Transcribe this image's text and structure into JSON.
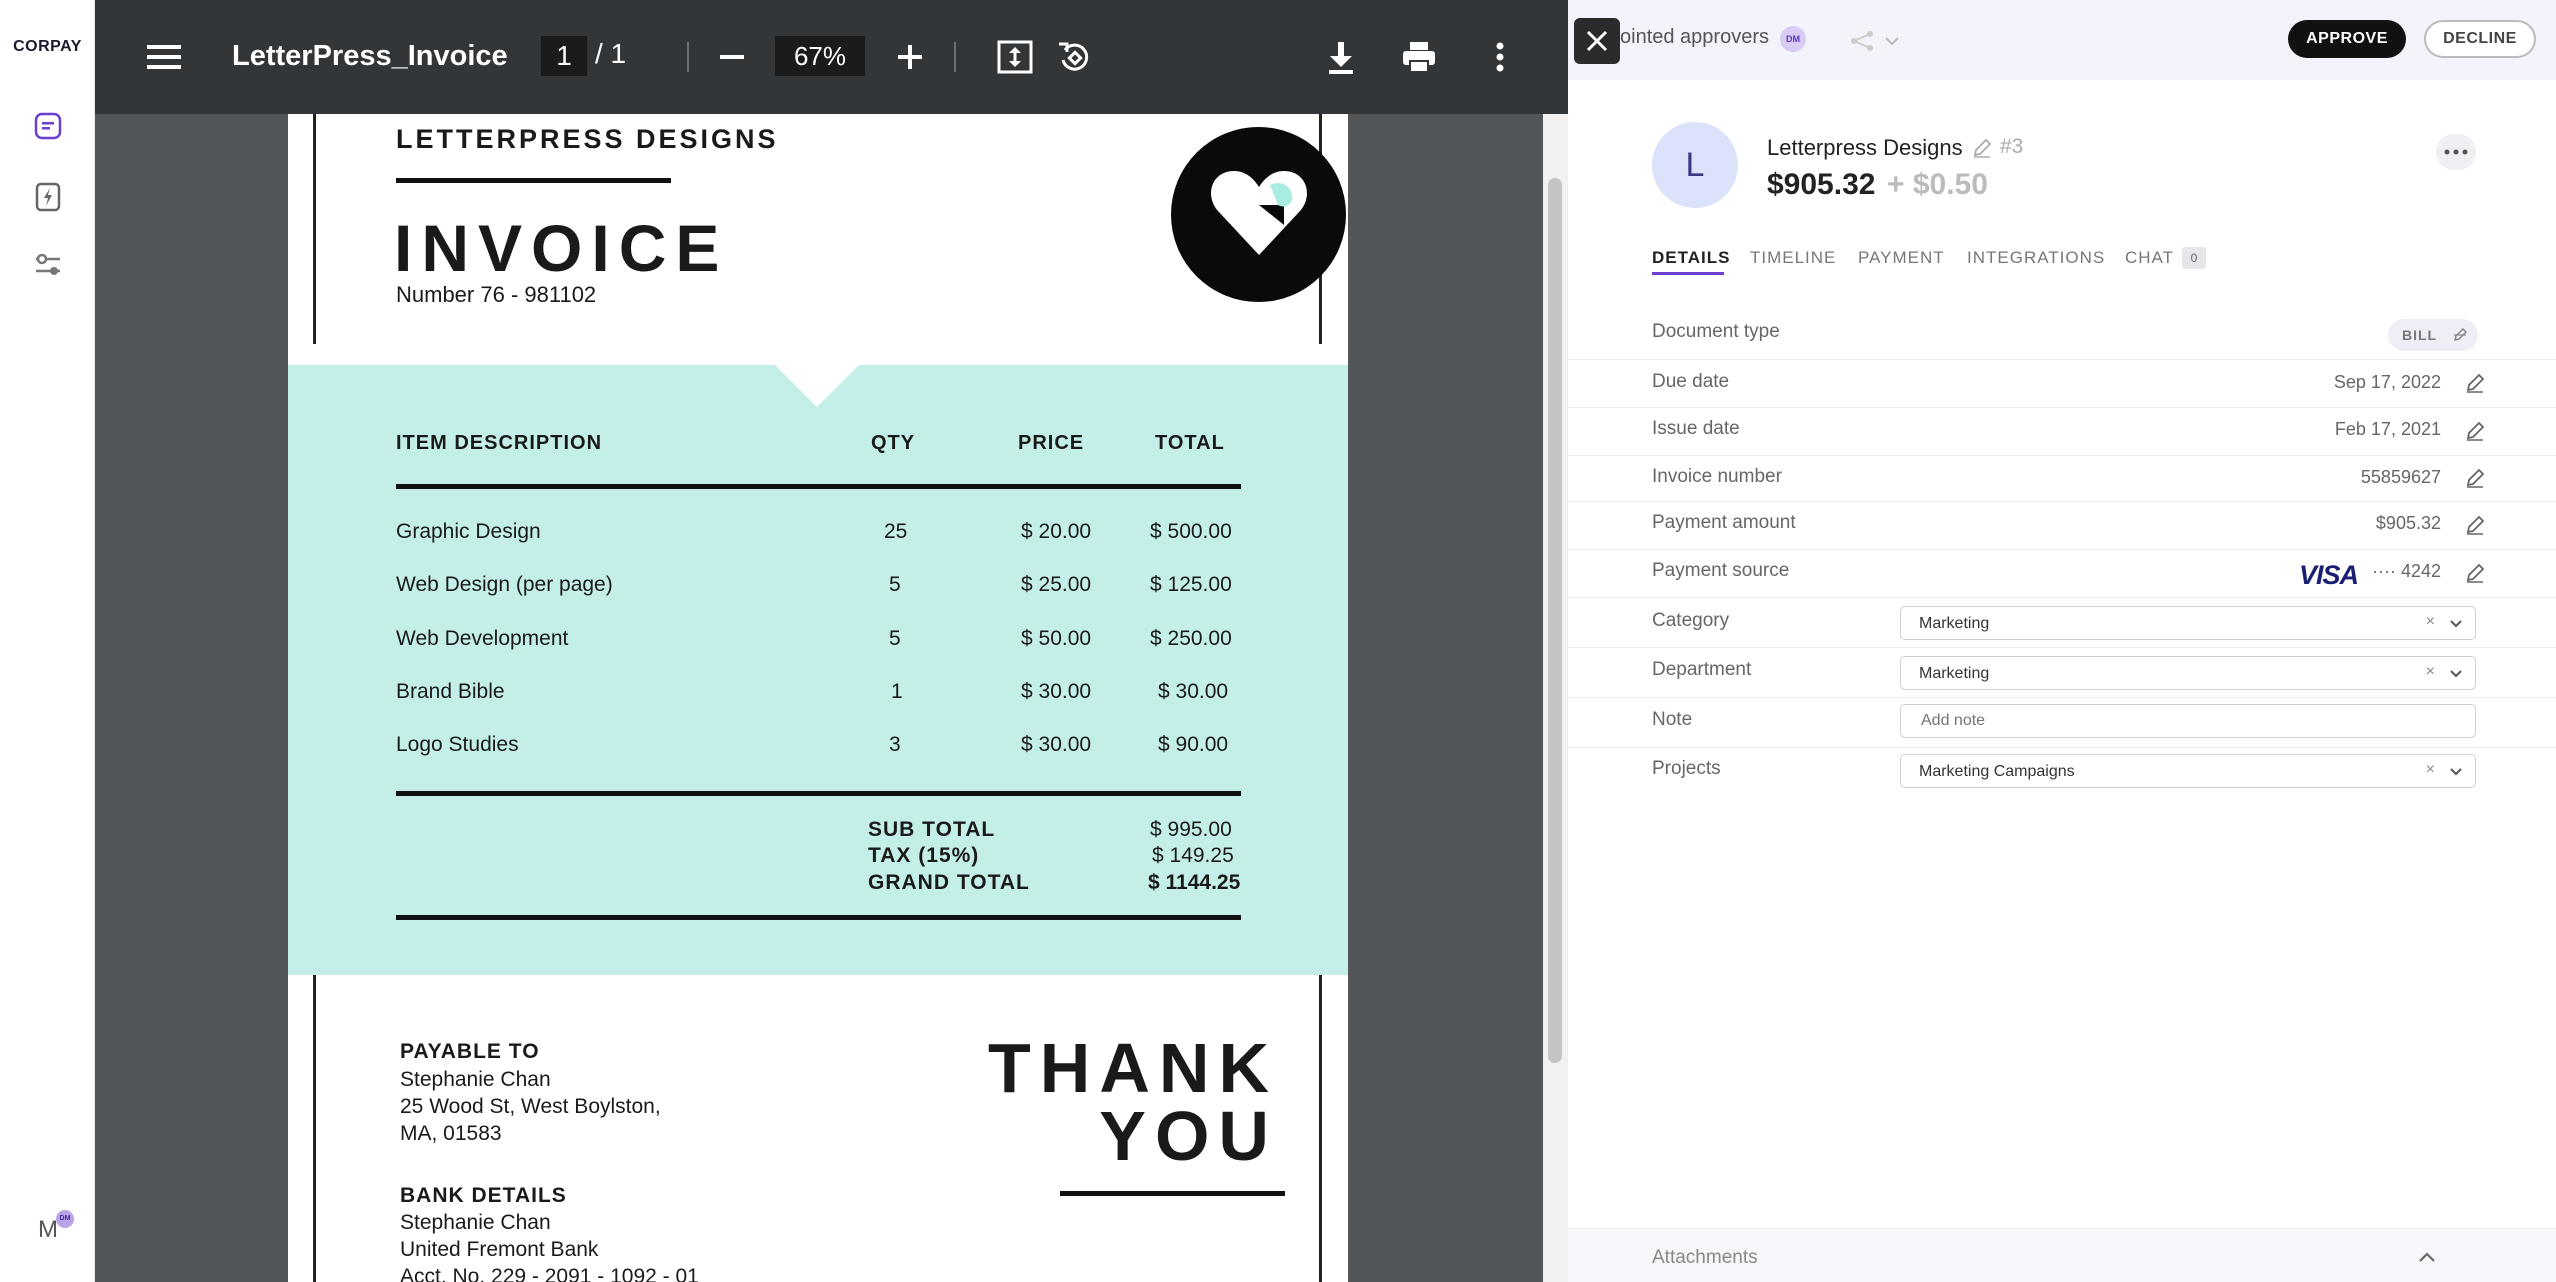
{
  "app": {
    "brand": "CORPAY",
    "user_initial": "M",
    "user_badge": "DM"
  },
  "viewer": {
    "title": "LetterPress_Invoice",
    "page_current": "1",
    "page_total": "/ 1",
    "zoom": "67%"
  },
  "invoice": {
    "company": "LETTERPRESS DESIGNS",
    "title": "INVOICE",
    "number": "Number 76 - 981102",
    "headers": {
      "description": "ITEM DESCRIPTION",
      "qty": "QTY",
      "price": "PRICE",
      "total": "TOTAL"
    },
    "items": [
      {
        "description": "Graphic Design",
        "qty": "25",
        "price": "$ 20.00",
        "total": "$ 500.00"
      },
      {
        "description": "Web Design (per page)",
        "qty": "5",
        "price": "$ 25.00",
        "total": "$ 125.00"
      },
      {
        "description": "Web Development",
        "qty": "5",
        "price": "$ 50.00",
        "total": "$ 250.00"
      },
      {
        "description": "Brand Bible",
        "qty": "1",
        "price": "$ 30.00",
        "total": "$ 30.00"
      },
      {
        "description": "Logo Studies",
        "qty": "3",
        "price": "$ 30.00",
        "total": "$ 90.00"
      }
    ],
    "subtotal_label": "SUB TOTAL",
    "subtotal": "$ 995.00",
    "tax_label": "TAX (15%)",
    "tax": "$ 149.25",
    "grand_total_label": "GRAND TOTAL",
    "grand_total": "$ 1144.25",
    "payable_label": "PAYABLE TO",
    "payable_name": "Stephanie Chan",
    "payable_address1": "25 Wood St, West Boylston,",
    "payable_address2": "MA, 01583",
    "bank_label": "BANK DETAILS",
    "bank_name": "Stephanie Chan",
    "bank_bank": "United Fremont Bank",
    "bank_account": "Acct. No. 229 - 2091 - 1092 - 01",
    "thanks_line1": "THANK",
    "thanks_line2": "YOU"
  },
  "panel": {
    "approvers_label": "ointed approvers",
    "approver_badge": "DM",
    "approve": "APPROVE",
    "decline": "DECLINE",
    "vendor_initial": "L",
    "vendor_name": "Letterpress Designs",
    "vendor_number": "#3",
    "amount": "$905.32",
    "fee": "+ $0.50",
    "tabs": [
      "DETAILS",
      "TIMELINE",
      "PAYMENT",
      "INTEGRATIONS",
      "CHAT"
    ],
    "chat_count": "0",
    "document_type_label": "Document type",
    "document_type": "BILL",
    "fields": [
      {
        "label": "Due date",
        "value": "Sep 17, 2022"
      },
      {
        "label": "Issue date",
        "value": "Feb 17, 2021"
      },
      {
        "label": "Invoice number",
        "value": "55859627"
      },
      {
        "label": "Payment amount",
        "value": "$905.32"
      }
    ],
    "payment_source_label": "Payment source",
    "payment_source_brand": "VISA",
    "payment_source_last4": "···· 4242",
    "category_label": "Category",
    "category_value": "Marketing",
    "department_label": "Department",
    "department_value": "Marketing",
    "note_label": "Note",
    "note_placeholder": "Add note",
    "projects_label": "Projects",
    "projects_value": "Marketing Campaigns",
    "attachments_label": "Attachments"
  },
  "colors": {
    "accent": "#6b3fd0",
    "mint": "#c4efe8",
    "toolbar": "#323639",
    "viewer_bg": "#525659",
    "visa_blue": "#1a1f71"
  }
}
